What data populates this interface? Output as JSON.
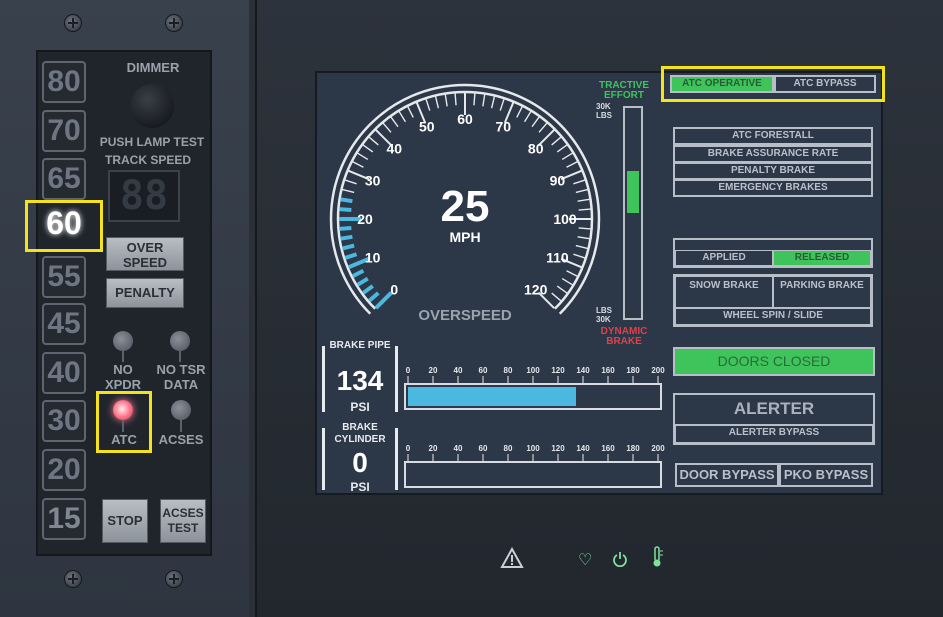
{
  "left_panel": {
    "speed_buttons": [
      "80",
      "70",
      "65",
      "60",
      "55",
      "45",
      "40",
      "30",
      "20",
      "15"
    ],
    "active_speed": "60",
    "dimmer_label": "DIMMER",
    "lamp_test_label": "PUSH LAMP TEST",
    "track_speed_label": "TRACK  SPEED",
    "track_speed_digits": "88",
    "overspeed_button": "OVER SPEED",
    "penalty_button": "PENALTY",
    "no_xpdr_label": "NO XPDR",
    "no_tsr_label": "NO TSR DATA",
    "atc_label": "ATC",
    "acses_label": "ACSES",
    "stop_button": "STOP",
    "acses_test_button": "ACSES TEST"
  },
  "speedometer": {
    "ticks": [
      "0",
      "10",
      "20",
      "30",
      "40",
      "50",
      "60",
      "70",
      "80",
      "90",
      "100",
      "110",
      "120"
    ],
    "speed_value": "25",
    "unit": "MPH",
    "overspeed_label": "OVERSPEED",
    "current_speed_mph": 25,
    "max_mph": 120
  },
  "tractive": {
    "title_top": "TRACTIVE EFFORT",
    "top_scale": "30K LBS",
    "bottom_scale": "LBS 30K",
    "title_bottom": "DYNAMIC BRAKE",
    "tractive_fraction": 0.25
  },
  "brake_pipe": {
    "label": "BRAKE PIPE",
    "value": "134",
    "unit": "PSI",
    "scale": [
      "0",
      "20",
      "40",
      "60",
      "80",
      "100",
      "120",
      "140",
      "160",
      "180",
      "200"
    ],
    "fill_value": 134,
    "max": 200
  },
  "brake_cylinder": {
    "label": "BRAKE CYLINDER",
    "value": "0",
    "unit": "PSI",
    "scale": [
      "0",
      "20",
      "40",
      "60",
      "80",
      "100",
      "120",
      "140",
      "160",
      "180",
      "200"
    ],
    "fill_value": 0,
    "max": 200
  },
  "status": {
    "atc_operative": "ATC OPERATIVE",
    "atc_bypass": "ATC BYPASS",
    "atc_forestall": "ATC FORESTALL",
    "brake_assurance": "BRAKE ASSURANCE RATE",
    "penalty_brake": "PENALTY BRAKE",
    "emergency_brakes": "EMERGENCY BRAKES",
    "applied": "APPLIED",
    "released": "RELEASED",
    "snow_brake": "SNOW BRAKE",
    "parking_brake": "PARKING BRAKE",
    "wheel_spin": "WHEEL SPIN / SLIDE",
    "doors_closed": "DOORS CLOSED",
    "alerter": "ALERTER",
    "alerter_bypass": "ALERTER BYPASS",
    "door_bypass": "DOOR BYPASS",
    "pko_bypass": "PKO BYPASS"
  },
  "icons": [
    "warning-icon",
    "heart-icon",
    "power-icon",
    "thermometer-icon"
  ],
  "colors": {
    "accent_green": "#3ec45a",
    "highlight": "#f4e31a",
    "gauge_blue": "#4bb8e0",
    "brake_red": "#e0404a"
  }
}
